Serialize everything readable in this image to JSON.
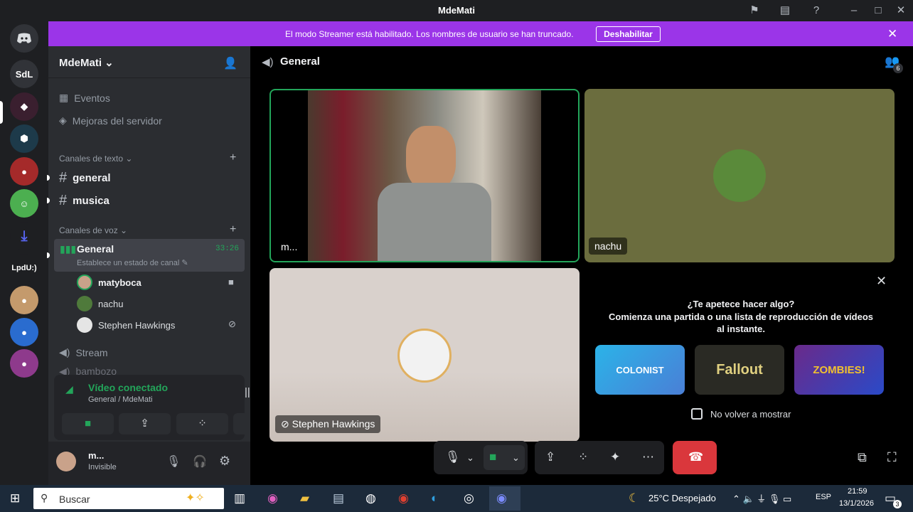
{
  "titlebar": {
    "title": "MdeMati"
  },
  "banner": {
    "text": "El modo Streamer está habilitado. Los nombres de usuario se han truncado.",
    "button": "Deshabilitar"
  },
  "servers": {
    "sdl": "SdL",
    "lpdu": "LpdU:)"
  },
  "server": {
    "name": "MdeMati",
    "events": "Eventos",
    "boosts": "Mejoras del servidor"
  },
  "categories": {
    "text": "Canales de texto",
    "voice": "Canales de voz"
  },
  "text_channels": [
    "general",
    "musica"
  ],
  "voice_channel": {
    "name": "General",
    "time": "33:26",
    "status": "Establece un estado de canal"
  },
  "members": [
    "matyboca",
    "nachu",
    "Stephen Hawkings"
  ],
  "other_channels": {
    "stream": "Stream",
    "truncated": "bambozo"
  },
  "connection": {
    "status": "Vídeo conectado",
    "location": "General / MdeMati"
  },
  "user": {
    "name": "m...",
    "status": "Invisible"
  },
  "main": {
    "channel": "General",
    "badge": "6"
  },
  "tiles": {
    "t1": "m...",
    "t2": "nachu",
    "t3": "Stephen Hawkings"
  },
  "activity": {
    "title": "¿Te apetece hacer algo?",
    "subtitle": "Comienza una partida o una lista de reproducción de vídeos al instante.",
    "dont_show": "No volver a mostrar"
  },
  "games": [
    "COLONIST",
    "Fallout",
    "ZOMBIES!"
  ],
  "taskbar": {
    "search": "Buscar",
    "weather": "25°C  Despejado",
    "lang": "ESP",
    "time": "21:59",
    "date": "13/1/2026",
    "notif": "3"
  },
  "colors": {
    "accent": "#9b35e8",
    "green": "#23a55a",
    "red": "#da373c"
  }
}
